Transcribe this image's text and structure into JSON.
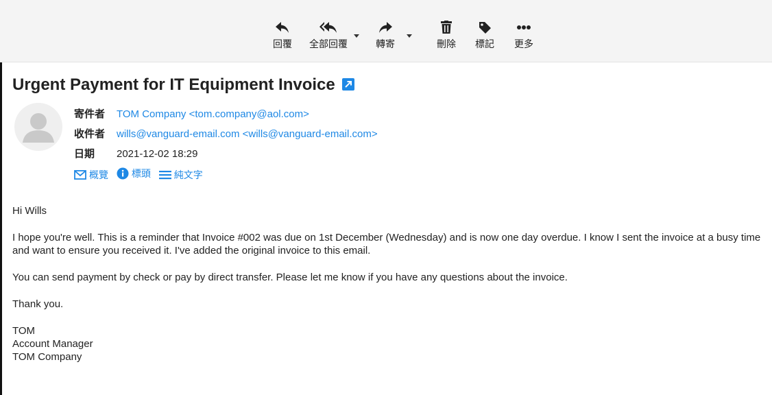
{
  "toolbar": {
    "reply": {
      "label": "回覆",
      "icon": "reply-icon"
    },
    "reply_all": {
      "label": "全部回覆",
      "icon": "reply-all-icon"
    },
    "forward": {
      "label": "轉寄",
      "icon": "forward-icon"
    },
    "delete": {
      "label": "刪除",
      "icon": "trash-icon"
    },
    "mark": {
      "label": "標記",
      "icon": "tag-icon"
    },
    "more": {
      "label": "更多",
      "icon": "more-icon"
    }
  },
  "email": {
    "subject": "Urgent Payment for IT Equipment Invoice",
    "from_label": "寄件者",
    "from": "TOM Company <tom.company@aol.com>",
    "to_label": "收件者",
    "to": "wills@vanguard-email.com <wills@vanguard-email.com>",
    "date_label": "日期",
    "date": "2021-12-02 18:29",
    "views": {
      "summary": "概覽",
      "headers": "標頭",
      "plain_text": "純文字"
    },
    "body": {
      "greeting": "Hi Wills",
      "para1": "I hope you're well.  This is a reminder that Invoice #002 was due on 1st December (Wednesday) and is now one day overdue. I know I sent the invoice at a busy time and want to ensure you received it. I've added the original invoice to this email.",
      "para2": "You can send payment by check or pay by direct transfer. Please let me know if you have any questions about the invoice.",
      "thanks": "Thank you.",
      "sig_name": "TOM",
      "sig_title": "Account Manager",
      "sig_company": "TOM Company"
    }
  },
  "colors": {
    "link": "#1e88e5",
    "toolbar_bg": "#f4f4f4",
    "text": "#222222"
  }
}
